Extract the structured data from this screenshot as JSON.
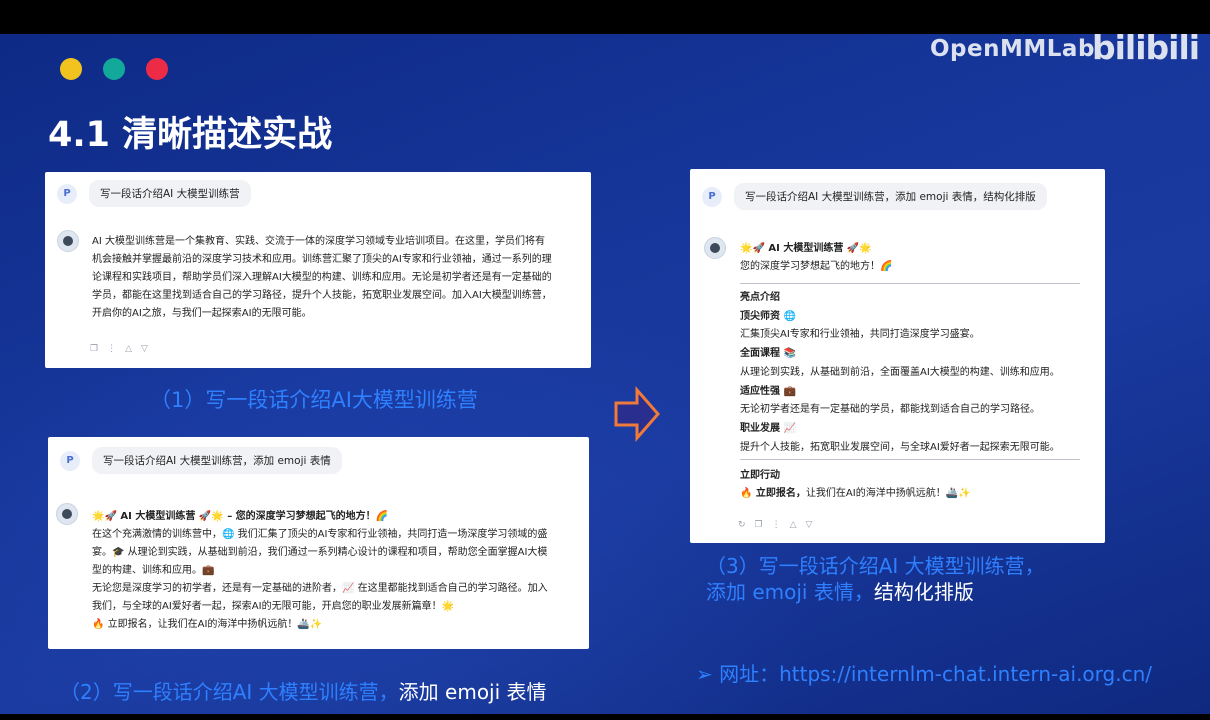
{
  "header": {
    "brand": "OpenMMLab",
    "watermark": "bilibili",
    "title": "4.1 清晰描述实战",
    "dots": [
      "#f2c31f",
      "#13a99a",
      "#ee2b47"
    ]
  },
  "card1": {
    "avatar_letter": "P",
    "prompt": "写一段话介绍AI 大模型训练营",
    "response_lines": [
      "AI 大模型训练营是一个集教育、实践、交流于一体的深度学习领域专业培训项目。在这里，学员们将有",
      "机会接触并掌握最前沿的深度学习技术和应用。训练营汇聚了顶尖的AI专家和行业领袖，通过一系列的理",
      "论课程和实践项目，帮助学员们深入理解AI大模型的构建、训练和应用。无论是初学者还是有一定基础的",
      "学员，都能在这里找到适合自己的学习路径，提升个人技能，拓宽职业发展空间。加入AI大模型训练营，",
      "开启你的AI之旅，与我们一起探索AI的无限可能。"
    ],
    "caption": "（1）写一段话介绍AI大模型训练营"
  },
  "card2": {
    "avatar_letter": "P",
    "prompt": "写一段话介绍AI 大模型训练营，添加 emoji 表情",
    "response_lines": [
      "🌟🚀 AI 大模型训练营 🚀🌟 – 您的深度学习梦想起飞的地方！🌈",
      "在这个充满激情的训练营中，🌐 我们汇集了顶尖的AI专家和行业领袖，共同打造一场深度学习领域的盛",
      "宴。🎓 从理论到实践，从基础到前沿，我们通过一系列精心设计的课程和项目，帮助您全面掌握AI大模",
      "型的构建、训练和应用。💼",
      "无论您是深度学习的初学者，还是有一定基础的进阶者，📈 在这里都能找到适合自己的学习路径。加入",
      "我们，与全球的AI爱好者一起，探索AI的无限可能，开启您的职业发展新篇章！🌟",
      "🔥 立即报名，让我们在AI的海洋中扬帆远航！🚢✨"
    ],
    "caption_main": "（2）写一段话介绍AI 大模型训练营，",
    "caption_hl": "添加 emoji 表情"
  },
  "card3": {
    "avatar_letter": "P",
    "prompt": "写一段话介绍AI 大模型训练营，添加 emoji 表情，结构化排版",
    "heading": "🌟🚀 AI 大模型训练营 🚀🌟",
    "subheading": "您的深度学习梦想起飞的地方！🌈",
    "section_title": "亮点介绍",
    "items": [
      {
        "title": "顶尖师资 🌐",
        "text": "汇集顶尖AI专家和行业领袖，共同打造深度学习盛宴。"
      },
      {
        "title": "全面课程 📚",
        "text": "从理论到实践，从基础到前沿，全面覆盖AI大模型的构建、训练和应用。"
      },
      {
        "title": "适应性强 💼",
        "text": "无论初学者还是有一定基础的学员，都能找到适合自己的学习路径。"
      },
      {
        "title": "职业发展 📈",
        "text": "提升个人技能，拓宽职业发展空间，与全球AI爱好者一起探索无限可能。"
      }
    ],
    "action_title": "立即行动",
    "action_bold": "🔥 立即报名，",
    "action_text": "让我们在AI的海洋中扬帆远航！🚢✨",
    "caption_line1": "（3）写一段话介绍AI 大模型训练营，",
    "caption_line2_main": "添加 emoji 表情，",
    "caption_line2_hl": "结构化排版"
  },
  "footer": {
    "url_prefix": "➢  网址：",
    "url": "https://internlm-chat.intern-ai.org.cn/"
  },
  "icons": [
    "copy-icon",
    "more-icon",
    "thumbs-up-icon",
    "thumbs-down-icon",
    "refresh-icon",
    "arrow-right-icon"
  ]
}
